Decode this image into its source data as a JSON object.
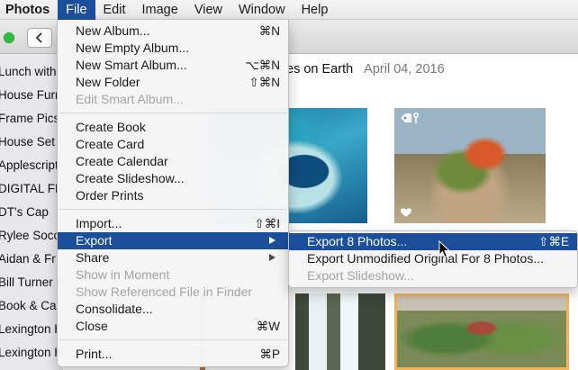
{
  "menubar": {
    "app": "Photos",
    "items": [
      "File",
      "Edit",
      "Image",
      "View",
      "Window",
      "Help"
    ]
  },
  "toolbar": {
    "back_icon": "chevron-left-icon"
  },
  "sidebar": {
    "items": [
      "Lunch with",
      "House Furn",
      "Frame Pics",
      "House Set U",
      "Applescript",
      "DIGITAL FR",
      "DT's Cap",
      "Rylee Socc",
      "Aidan & Fr",
      "Bill Turner &",
      "Book & Cale",
      "Lexington H",
      "Lexington H"
    ]
  },
  "content": {
    "title": "es on Earth",
    "date": "April 04, 2016"
  },
  "file_menu": {
    "items": [
      {
        "label": "New Album...",
        "shortcut": "⌘N"
      },
      {
        "label": "New Empty Album...",
        "shortcut": ""
      },
      {
        "label": "New Smart Album...",
        "shortcut": "⌥⌘N"
      },
      {
        "label": "New Folder",
        "shortcut": "⇧⌘N"
      },
      {
        "label": "Edit Smart Album...",
        "shortcut": "",
        "disabled": true
      },
      {
        "label": "Create Book",
        "shortcut": ""
      },
      {
        "label": "Create Card",
        "shortcut": ""
      },
      {
        "label": "Create Calendar",
        "shortcut": ""
      },
      {
        "label": "Create Slideshow...",
        "shortcut": ""
      },
      {
        "label": "Order Prints",
        "shortcut": ""
      },
      {
        "label": "Import...",
        "shortcut": "⇧⌘I"
      },
      {
        "label": "Export",
        "shortcut": "",
        "submenu": true,
        "highlighted": true
      },
      {
        "label": "Share",
        "shortcut": "",
        "submenu": true
      },
      {
        "label": "Show in Moment",
        "shortcut": "",
        "disabled": true
      },
      {
        "label": "Show Referenced File in Finder",
        "shortcut": "",
        "disabled": true
      },
      {
        "label": "Consolidate...",
        "shortcut": ""
      },
      {
        "label": "Close",
        "shortcut": "⌘W"
      },
      {
        "label": "Print...",
        "shortcut": "⌘P"
      }
    ]
  },
  "export_submenu": {
    "items": [
      {
        "label": "Export 8 Photos...",
        "shortcut": "⇧⌘E",
        "highlighted": true
      },
      {
        "label": "Export Unmodified Original For 8 Photos...",
        "shortcut": ""
      },
      {
        "label": "Export Slideshow...",
        "shortcut": "",
        "disabled": true
      }
    ]
  },
  "colors": {
    "highlight": "#1b4f9c",
    "traffic_green": "#2fbd3c"
  }
}
